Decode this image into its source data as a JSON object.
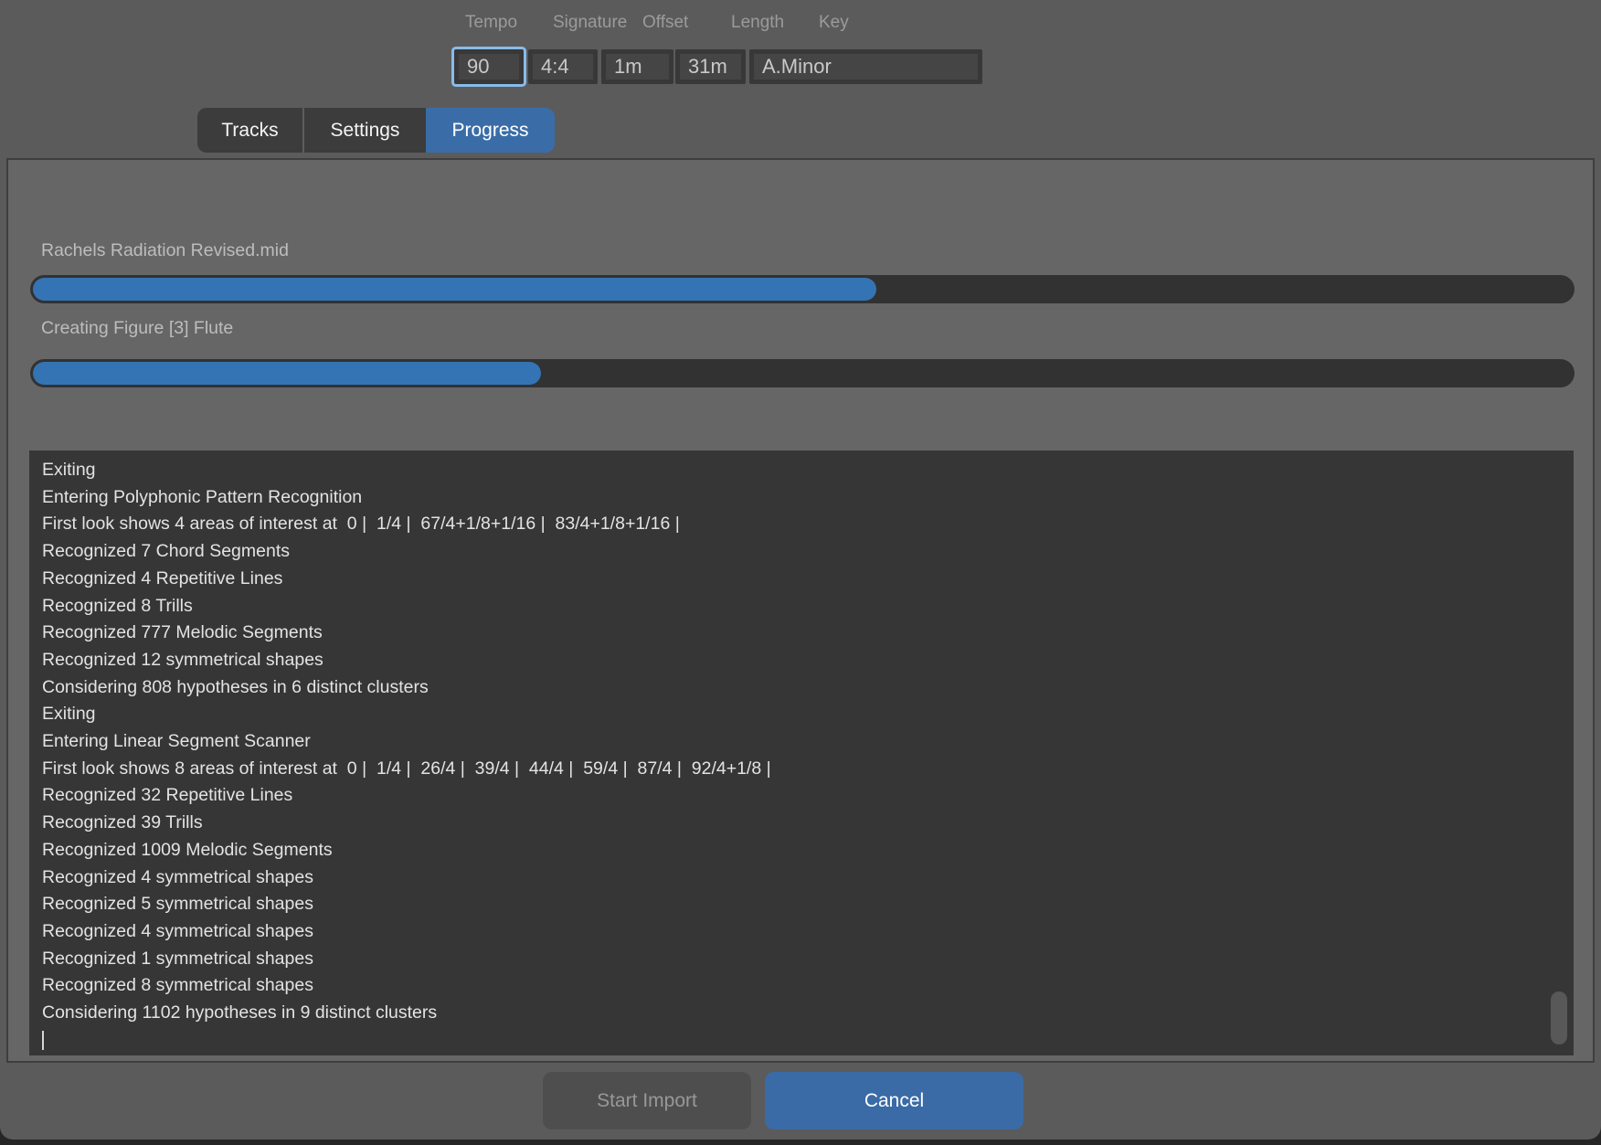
{
  "header": {
    "fields": [
      {
        "label": "Tempo",
        "value": "90",
        "focused": true
      },
      {
        "label": "Signature",
        "value": "4:4",
        "focused": false
      },
      {
        "label": "Offset",
        "value": "1m",
        "focused": false
      },
      {
        "label": "Length",
        "value": "31m",
        "focused": false
      },
      {
        "label": "Key",
        "value": "A.Minor",
        "focused": false
      }
    ]
  },
  "tabs": [
    {
      "label": "Tracks",
      "active": false
    },
    {
      "label": "Settings",
      "active": false
    },
    {
      "label": "Progress",
      "active": true
    }
  ],
  "progress": {
    "file_label": "Rachels Radiation Revised.mid",
    "file_percent": 54.8,
    "task_label": "Creating Figure [3] Flute",
    "task_percent": 33
  },
  "log": {
    "lines": [
      "Exiting",
      "Entering Polyphonic Pattern Recognition",
      "First look shows 4 areas of interest at  0 |  1/4 |  67/4+1/8+1/16 |  83/4+1/8+1/16 |",
      "Recognized 7 Chord Segments",
      "Recognized 4 Repetitive Lines",
      "Recognized 8 Trills",
      "Recognized 777 Melodic Segments",
      "Recognized 12 symmetrical shapes",
      "Considering 808 hypotheses in 6 distinct clusters",
      "Exiting",
      "Entering Linear Segment Scanner",
      "First look shows 8 areas of interest at  0 |  1/4 |  26/4 |  39/4 |  44/4 |  59/4 |  87/4 |  92/4+1/8 |",
      "Recognized 32 Repetitive Lines",
      "Recognized 39 Trills",
      "Recognized 1009 Melodic Segments",
      "Recognized 4 symmetrical shapes",
      "Recognized 5 symmetrical shapes",
      "Recognized 4 symmetrical shapes",
      "Recognized 1 symmetrical shapes",
      "Recognized 8 symmetrical shapes",
      "Considering 1102 hypotheses in 9 distinct clusters"
    ],
    "cursor": "|"
  },
  "footer": {
    "start_label": "Start Import",
    "cancel_label": "Cancel"
  },
  "colors": {
    "accent_blue": "#3a6da8",
    "progress_fill": "#3474b5",
    "focus_ring": "#8abbe9",
    "panel_bg": "#666666",
    "log_bg": "#363636"
  }
}
